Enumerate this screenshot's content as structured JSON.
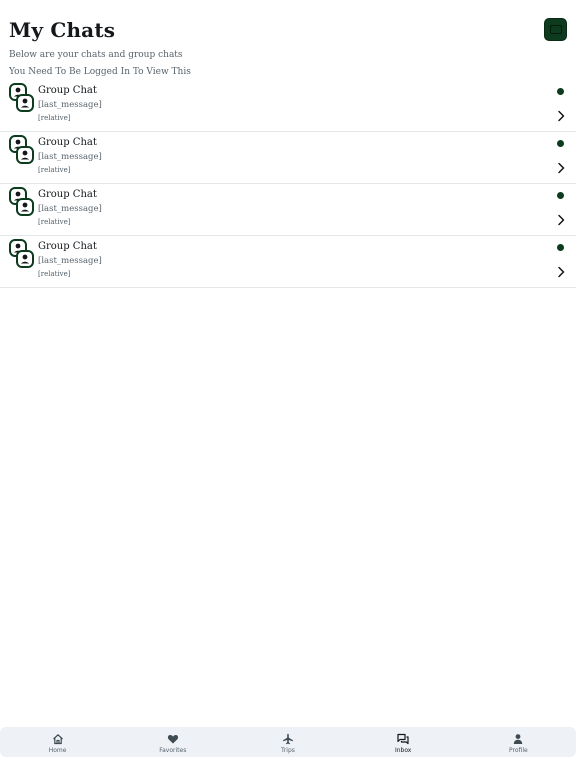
{
  "header": {
    "title": "My Chats",
    "subtitle": "Below are your chats and group chats"
  },
  "login_notice": "You Need To Be Logged In To View This",
  "chats": [
    {
      "title": "Group Chat",
      "message": "[last_message]",
      "time": "[relative]",
      "unread": true
    },
    {
      "title": "Group Chat",
      "message": "[last_message]",
      "time": "[relative]",
      "unread": true
    },
    {
      "title": "Group Chat",
      "message": "[last_message]",
      "time": "[relative]",
      "unread": true
    },
    {
      "title": "Group Chat",
      "message": "[last_message]",
      "time": "[relative]",
      "unread": true
    }
  ],
  "nav": {
    "items": [
      {
        "label": "Home",
        "icon": "home-icon"
      },
      {
        "label": "Favorites",
        "icon": "heart-icon"
      },
      {
        "label": "Trips",
        "icon": "airplane-icon"
      },
      {
        "label": "Inbox",
        "icon": "chat-bubbles-icon",
        "active": true
      },
      {
        "label": "Profile",
        "icon": "person-icon"
      }
    ]
  },
  "colors": {
    "accent": "#0c3b1e",
    "text_primary": "#14181b",
    "text_secondary": "#57636c",
    "nav_background": "#eef1f5",
    "divider": "#e4e7ea"
  }
}
